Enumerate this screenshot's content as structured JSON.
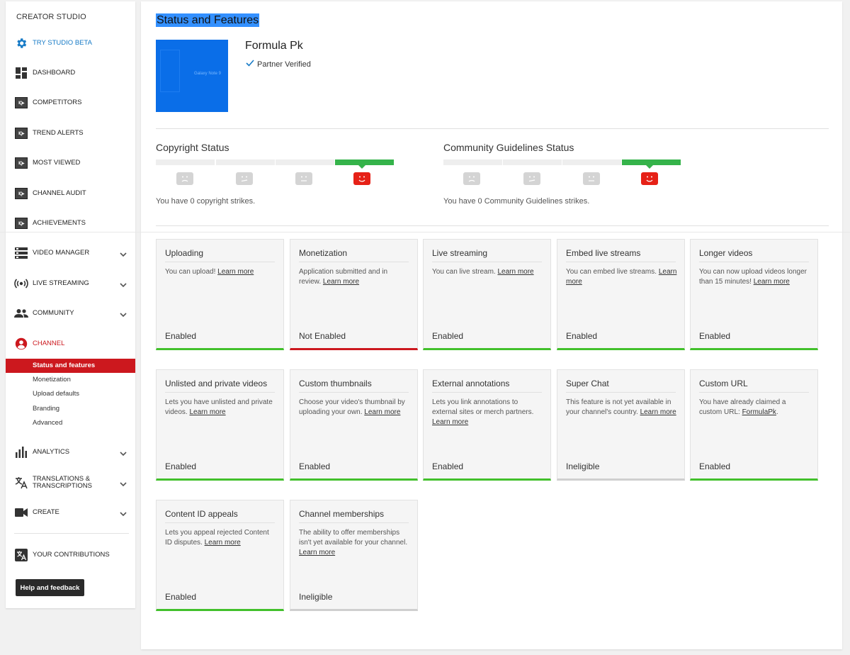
{
  "sidebar": {
    "title": "CREATOR STUDIO",
    "top_items": [
      {
        "label": "TRY STUDIO BETA",
        "icon": "gear-icon"
      },
      {
        "label": "DASHBOARD",
        "icon": "dashboard-icon"
      },
      {
        "label": "COMPETITORS",
        "icon": "iq-icon"
      },
      {
        "label": "TREND ALERTS",
        "icon": "iq-icon"
      },
      {
        "label": "MOST VIEWED",
        "icon": "iq-icon"
      },
      {
        "label": "CHANNEL AUDIT",
        "icon": "iq-icon"
      },
      {
        "label": "ACHIEVEMENTS",
        "icon": "iq-icon"
      }
    ],
    "sections": [
      {
        "label": "VIDEO MANAGER",
        "icon": "video-manager-icon"
      },
      {
        "label": "LIVE STREAMING",
        "icon": "live-streaming-icon"
      },
      {
        "label": "COMMUNITY",
        "icon": "community-icon"
      },
      {
        "label": "CHANNEL",
        "icon": "channel-icon"
      }
    ],
    "channel_sub": [
      "Status and features",
      "Monetization",
      "Upload defaults",
      "Branding",
      "Advanced"
    ],
    "lower_sections": [
      {
        "label": "ANALYTICS",
        "icon": "analytics-icon"
      },
      {
        "label": "TRANSLATIONS & TRANSCRIPTIONS",
        "icon": "translate-icon"
      },
      {
        "label": "CREATE",
        "icon": "camera-icon"
      }
    ],
    "contributions": "YOUR CONTRIBUTIONS",
    "help_button": "Help and feedback"
  },
  "main": {
    "page_title": "Status and Features",
    "channel_name": "Formula Pk",
    "verified_label": "Partner Verified",
    "thumbnail_text": "Galaxy Note 9",
    "copyright": {
      "heading": "Copyright Status",
      "text": "You have 0 copyright strikes.",
      "strikes": 0
    },
    "community": {
      "heading": "Community Guidelines Status",
      "text": "You have 0 Community Guidelines strikes.",
      "strikes": 0
    }
  },
  "features": [
    {
      "title": "Uploading",
      "desc": "You can upload!",
      "link": "Learn more",
      "status": "Enabled",
      "state": "green"
    },
    {
      "title": "Monetization",
      "desc": "Application submitted and in review.",
      "link": "Learn more",
      "status": "Not Enabled",
      "state": "red"
    },
    {
      "title": "Live streaming",
      "desc": "You can live stream.",
      "link": "Learn more",
      "status": "Enabled",
      "state": "green"
    },
    {
      "title": "Embed live streams",
      "desc": "You can embed live streams.",
      "link": "Learn more",
      "status": "Enabled",
      "state": "green"
    },
    {
      "title": "Longer videos",
      "desc": "You can now upload videos longer than 15 minutes!",
      "link": "Learn more",
      "status": "Enabled",
      "state": "green"
    },
    {
      "title": "Unlisted and private videos",
      "desc": "Lets you have unlisted and private videos.",
      "link": "Learn more",
      "status": "Enabled",
      "state": "green"
    },
    {
      "title": "Custom thumbnails",
      "desc": "Choose your video's thumbnail by uploading your own.",
      "link": "Learn more",
      "status": "Enabled",
      "state": "green"
    },
    {
      "title": "External annotations",
      "desc": "Lets you link annotations to external sites or merch partners.",
      "link": "Learn more",
      "status": "Enabled",
      "state": "green"
    },
    {
      "title": "Super Chat",
      "desc": "This feature is not yet available in your channel's country.",
      "link": "Learn more",
      "status": "Ineligible",
      "state": "grey"
    },
    {
      "title": "Custom URL",
      "desc": "You have already claimed a custom URL:",
      "link": "FormulaPk",
      "suffix": ".",
      "status": "Enabled",
      "state": "green"
    },
    {
      "title": "Content ID appeals",
      "desc": "Lets you appeal rejected Content ID disputes.",
      "link": "Learn more",
      "status": "Enabled",
      "state": "green"
    },
    {
      "title": "Channel memberships",
      "desc": "The ability to offer memberships isn't yet available for your channel.",
      "link": "Learn more",
      "status": "Ineligible",
      "state": "grey"
    }
  ],
  "colors": {
    "accent_blue": "#167ac6",
    "accent_red": "#cc181e",
    "enabled_green": "#42c02b",
    "strike_green": "#35b34a",
    "strike_red": "#e62117"
  }
}
